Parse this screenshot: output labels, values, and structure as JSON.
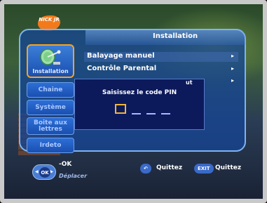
{
  "panel": {
    "title": "Installation"
  },
  "channel_logo": {
    "text": "NICK JR"
  },
  "sidebar": {
    "items": [
      {
        "label": "Installation",
        "selected": true
      },
      {
        "label": "Chaine"
      },
      {
        "label": "Système"
      },
      {
        "label": "Boite aux lettres"
      },
      {
        "label": "Irdeto"
      }
    ]
  },
  "menu": {
    "items": [
      {
        "label": "Balayage manuel"
      },
      {
        "label": "Contrôle Parental"
      }
    ],
    "partial_right_text": "ut"
  },
  "dialog": {
    "title": "Saisissez le code PIN",
    "pin_length": 4,
    "entered_digits": 0
  },
  "footer": {
    "ok_key": "OK",
    "ok_label": "-OK",
    "move_label": "Déplacer",
    "back_key": "↶",
    "back_label": "Quittez",
    "exit_key": "EXIT",
    "exit_label": "Quittez"
  },
  "colors": {
    "panel_border": "#7fb3f0",
    "selected_tab_border": "#f5a326",
    "pin_cursor": "#f2b43a"
  }
}
